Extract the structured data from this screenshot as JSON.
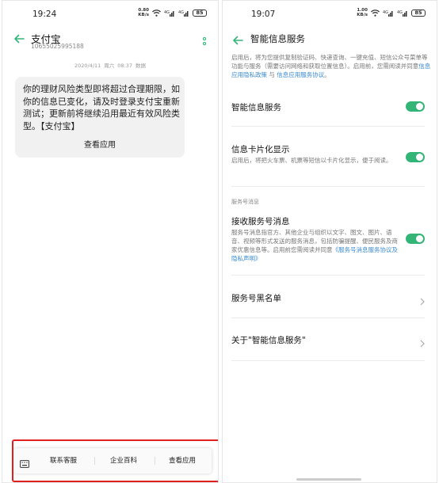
{
  "left": {
    "status": {
      "time": "19:24",
      "speed_value": "0.80",
      "speed_unit": "KB/s",
      "sig1": "4G",
      "sig2": "4G",
      "battery": "85"
    },
    "header": {
      "title": "支付宝",
      "number": "10655025995188"
    },
    "timestamp": {
      "date": "2020/4/11",
      "weekday": "周六",
      "time": "08:37",
      "tag": "数据"
    },
    "message": {
      "text": "你的理财风险类型即将超过合理期限，如你的信息已变化，请及时登录支付宝重新测试；更新前将继续沿用最近有效风险类型。【支付宝】",
      "action": "查看应用"
    },
    "bottom_bar": {
      "items": [
        "联系客服",
        "企业百科",
        "查看应用"
      ]
    }
  },
  "right": {
    "status": {
      "time": "19:07",
      "speed_value": "1.00",
      "speed_unit": "KB/s",
      "sig1": "4G",
      "sig2": "4G",
      "battery": "85"
    },
    "header": {
      "title": "智能信息服务"
    },
    "intro": {
      "text": "启用后，将为您提供复制验证码、快递查询、一键充值、短信公众号菜单等功能与服务（需要访问网络和获取位置信息）。启用前，您需阅读并同意",
      "link1": "信息应用隐私政策",
      "conj": "与",
      "link2": "信息应用服务协议",
      "end": "。"
    },
    "rows": {
      "smart": {
        "title": "智能信息服务"
      },
      "card": {
        "title": "信息卡片化显示",
        "desc": "启用后，将把火车票、机票等短信以卡片化显示，便于阅读。"
      },
      "section": "服务号消息",
      "receive": {
        "title": "接收服务号消息",
        "desc": "服务号消息指官方、其他企业与组织以文字、图文、图片、语音、视频等形式发送的服务消息，包括防骗提醒、便民服务及商家优惠信息等。启用前您需阅读并同意",
        "link": "《服务号消息服务协议及隐私声明》"
      },
      "blacklist": {
        "title": "服务号黑名单"
      },
      "about": {
        "title": "关于\"智能信息服务\""
      }
    }
  },
  "colors": {
    "accent_green": "#32b577",
    "link_blue": "#3a8bd0",
    "highlight_red": "#e0201e"
  }
}
